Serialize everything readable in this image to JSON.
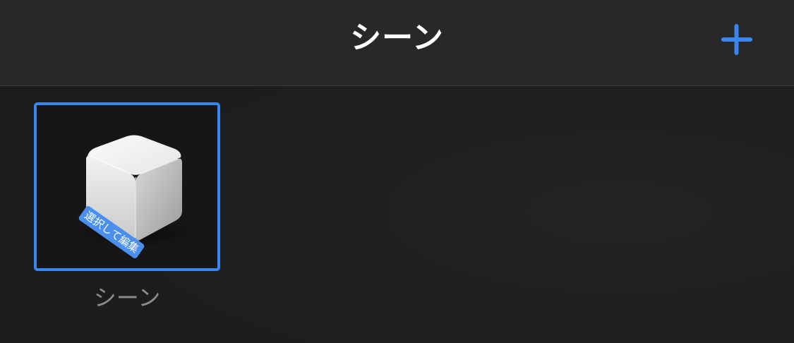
{
  "navbar": {
    "title": "シーン",
    "add_icon": "plus-icon",
    "accent_color": "#3a86f0"
  },
  "scenes": [
    {
      "name": "シーン",
      "thumbnail_icon": "cube-icon",
      "hint": "選択して編集",
      "selected": true
    }
  ]
}
